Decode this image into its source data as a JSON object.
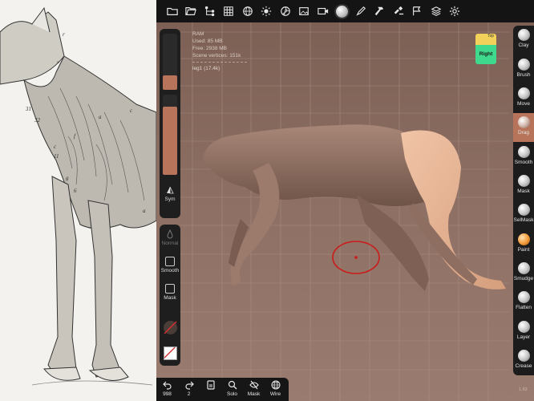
{
  "top_toolbar": {
    "icons": [
      "folder-icon",
      "folder-open-icon",
      "scene-tree-icon",
      "grid-icon",
      "globe-icon",
      "light-sun-icon",
      "camera-shutter-icon",
      "image-icon",
      "video-icon",
      "material-ball-icon",
      "brush-pen-icon",
      "hammer-icon",
      "gavel-icon",
      "flag-icon",
      "layers-icon",
      "settings-gear-icon"
    ]
  },
  "stats": {
    "ram_label": "RAM",
    "used": "Used: 85 MB",
    "free": "Free: 2938 MB",
    "vertices": "Scene vertices: 151k",
    "mesh": "leg1 (17.4k)"
  },
  "left_panel": {
    "sym_label": "Sym",
    "normal_label": "Normal",
    "smooth_label": "Smooth",
    "mask_label": "Mask",
    "slider_top_fill": 0.55,
    "slider_bottom_fill": 0.85,
    "brush_color": "#b7745a"
  },
  "bottom_toolbar": {
    "items": [
      {
        "label": "998",
        "icon": "undo-icon"
      },
      {
        "label": "2",
        "icon": "redo-icon"
      },
      {
        "label": "",
        "icon": "menu-icon"
      },
      {
        "label": "Solo",
        "icon": "search-icon"
      },
      {
        "label": "Mask",
        "icon": "eye-slash-icon"
      },
      {
        "label": "Wire",
        "icon": "wireframe-globe-icon"
      }
    ]
  },
  "tools": [
    {
      "label": "Clay"
    },
    {
      "label": "Brush"
    },
    {
      "label": "Move"
    },
    {
      "label": "Drag",
      "active": true
    },
    {
      "label": "Smooth"
    },
    {
      "label": "Mask"
    },
    {
      "label": "SelMask"
    },
    {
      "label": "Paint"
    },
    {
      "label": "Smudge"
    },
    {
      "label": "Flatten"
    },
    {
      "label": "Layer"
    },
    {
      "label": "Crease"
    }
  ],
  "cube": {
    "top": "Top",
    "front": "Right"
  },
  "version": "1.63",
  "colors": {
    "background": "#8d6e61",
    "accent": "#b7745a",
    "cube_top": "#f2d15a",
    "cube_front": "#3fd98d",
    "brush_ring": "#cc1a1a"
  }
}
